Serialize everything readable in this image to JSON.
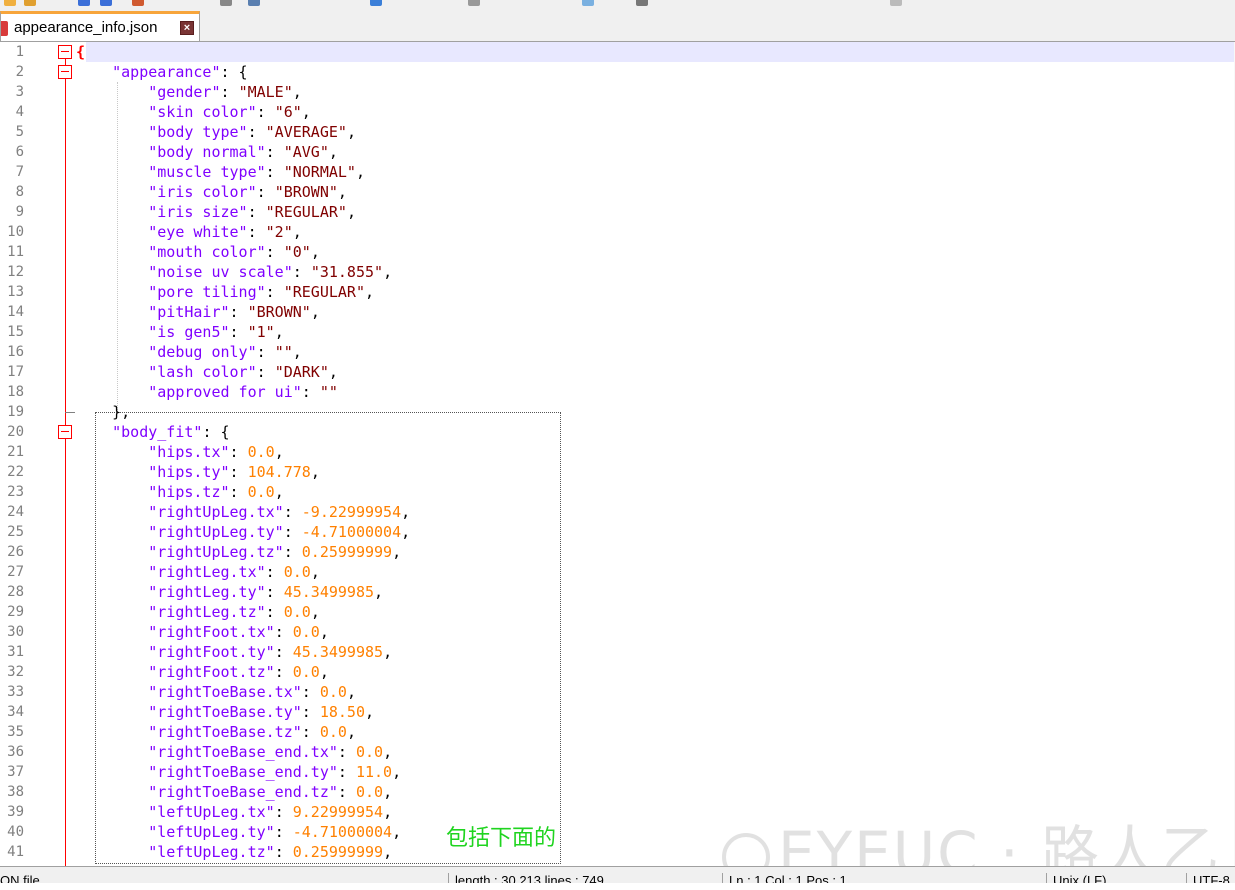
{
  "window": {
    "tab_title": "appearance_info.json",
    "close_glyph": "×"
  },
  "colors": {
    "key": "#8000ff",
    "string": "#800000",
    "number": "#ff8000",
    "fold_marker": "#ff0000",
    "caret_line": "#e8e8ff",
    "annotation": "#1fd41f"
  },
  "lines": [
    {
      "n": "1",
      "parts": [
        {
          "t": "{",
          "c": "brace-hl"
        }
      ]
    },
    {
      "n": "2",
      "parts": [
        {
          "t": "    "
        },
        {
          "t": "\"appearance\"",
          "c": "k"
        },
        {
          "t": ": {",
          "c": "p"
        }
      ]
    },
    {
      "n": "3",
      "parts": [
        {
          "t": "        "
        },
        {
          "t": "\"gender\"",
          "c": "k"
        },
        {
          "t": ": "
        },
        {
          "t": "\"MALE\"",
          "c": "s"
        },
        {
          "t": ","
        }
      ]
    },
    {
      "n": "4",
      "parts": [
        {
          "t": "        "
        },
        {
          "t": "\"skin color\"",
          "c": "k"
        },
        {
          "t": ": "
        },
        {
          "t": "\"6\"",
          "c": "s"
        },
        {
          "t": ","
        }
      ]
    },
    {
      "n": "5",
      "parts": [
        {
          "t": "        "
        },
        {
          "t": "\"body type\"",
          "c": "k"
        },
        {
          "t": ": "
        },
        {
          "t": "\"AVERAGE\"",
          "c": "s"
        },
        {
          "t": ","
        }
      ]
    },
    {
      "n": "6",
      "parts": [
        {
          "t": "        "
        },
        {
          "t": "\"body normal\"",
          "c": "k"
        },
        {
          "t": ": "
        },
        {
          "t": "\"AVG\"",
          "c": "s"
        },
        {
          "t": ","
        }
      ]
    },
    {
      "n": "7",
      "parts": [
        {
          "t": "        "
        },
        {
          "t": "\"muscle type\"",
          "c": "k"
        },
        {
          "t": ": "
        },
        {
          "t": "\"NORMAL\"",
          "c": "s"
        },
        {
          "t": ","
        }
      ]
    },
    {
      "n": "8",
      "parts": [
        {
          "t": "        "
        },
        {
          "t": "\"iris color\"",
          "c": "k"
        },
        {
          "t": ": "
        },
        {
          "t": "\"BROWN\"",
          "c": "s"
        },
        {
          "t": ","
        }
      ]
    },
    {
      "n": "9",
      "parts": [
        {
          "t": "        "
        },
        {
          "t": "\"iris size\"",
          "c": "k"
        },
        {
          "t": ": "
        },
        {
          "t": "\"REGULAR\"",
          "c": "s"
        },
        {
          "t": ","
        }
      ]
    },
    {
      "n": "10",
      "parts": [
        {
          "t": "        "
        },
        {
          "t": "\"eye white\"",
          "c": "k"
        },
        {
          "t": ": "
        },
        {
          "t": "\"2\"",
          "c": "s"
        },
        {
          "t": ","
        }
      ]
    },
    {
      "n": "11",
      "parts": [
        {
          "t": "        "
        },
        {
          "t": "\"mouth color\"",
          "c": "k"
        },
        {
          "t": ": "
        },
        {
          "t": "\"0\"",
          "c": "s"
        },
        {
          "t": ","
        }
      ]
    },
    {
      "n": "12",
      "parts": [
        {
          "t": "        "
        },
        {
          "t": "\"noise uv scale\"",
          "c": "k"
        },
        {
          "t": ": "
        },
        {
          "t": "\"31.855\"",
          "c": "s"
        },
        {
          "t": ","
        }
      ]
    },
    {
      "n": "13",
      "parts": [
        {
          "t": "        "
        },
        {
          "t": "\"pore tiling\"",
          "c": "k"
        },
        {
          "t": ": "
        },
        {
          "t": "\"REGULAR\"",
          "c": "s"
        },
        {
          "t": ","
        }
      ]
    },
    {
      "n": "14",
      "parts": [
        {
          "t": "        "
        },
        {
          "t": "\"pitHair\"",
          "c": "k"
        },
        {
          "t": ": "
        },
        {
          "t": "\"BROWN\"",
          "c": "s"
        },
        {
          "t": ","
        }
      ]
    },
    {
      "n": "15",
      "parts": [
        {
          "t": "        "
        },
        {
          "t": "\"is gen5\"",
          "c": "k"
        },
        {
          "t": ": "
        },
        {
          "t": "\"1\"",
          "c": "s"
        },
        {
          "t": ","
        }
      ]
    },
    {
      "n": "16",
      "parts": [
        {
          "t": "        "
        },
        {
          "t": "\"debug only\"",
          "c": "k"
        },
        {
          "t": ": "
        },
        {
          "t": "\"\"",
          "c": "s"
        },
        {
          "t": ","
        }
      ]
    },
    {
      "n": "17",
      "parts": [
        {
          "t": "        "
        },
        {
          "t": "\"lash color\"",
          "c": "k"
        },
        {
          "t": ": "
        },
        {
          "t": "\"DARK\"",
          "c": "s"
        },
        {
          "t": ","
        }
      ]
    },
    {
      "n": "18",
      "parts": [
        {
          "t": "        "
        },
        {
          "t": "\"approved for ui\"",
          "c": "k"
        },
        {
          "t": ": "
        },
        {
          "t": "\"\"",
          "c": "s"
        }
      ]
    },
    {
      "n": "19",
      "parts": [
        {
          "t": "    },"
        }
      ]
    },
    {
      "n": "20",
      "parts": [
        {
          "t": "    "
        },
        {
          "t": "\"body_fit\"",
          "c": "k"
        },
        {
          "t": ": {"
        }
      ]
    },
    {
      "n": "21",
      "parts": [
        {
          "t": "        "
        },
        {
          "t": "\"hips.tx\"",
          "c": "k"
        },
        {
          "t": ": "
        },
        {
          "t": "0.0",
          "c": "n"
        },
        {
          "t": ","
        }
      ]
    },
    {
      "n": "22",
      "parts": [
        {
          "t": "        "
        },
        {
          "t": "\"hips.ty\"",
          "c": "k"
        },
        {
          "t": ": "
        },
        {
          "t": "104.778",
          "c": "n"
        },
        {
          "t": ","
        }
      ]
    },
    {
      "n": "23",
      "parts": [
        {
          "t": "        "
        },
        {
          "t": "\"hips.tz\"",
          "c": "k"
        },
        {
          "t": ": "
        },
        {
          "t": "0.0",
          "c": "n"
        },
        {
          "t": ","
        }
      ]
    },
    {
      "n": "24",
      "parts": [
        {
          "t": "        "
        },
        {
          "t": "\"rightUpLeg.tx\"",
          "c": "k"
        },
        {
          "t": ": "
        },
        {
          "t": "-9.22999954",
          "c": "n"
        },
        {
          "t": ","
        }
      ]
    },
    {
      "n": "25",
      "parts": [
        {
          "t": "        "
        },
        {
          "t": "\"rightUpLeg.ty\"",
          "c": "k"
        },
        {
          "t": ": "
        },
        {
          "t": "-4.71000004",
          "c": "n"
        },
        {
          "t": ","
        }
      ]
    },
    {
      "n": "26",
      "parts": [
        {
          "t": "        "
        },
        {
          "t": "\"rightUpLeg.tz\"",
          "c": "k"
        },
        {
          "t": ": "
        },
        {
          "t": "0.25999999",
          "c": "n"
        },
        {
          "t": ","
        }
      ]
    },
    {
      "n": "27",
      "parts": [
        {
          "t": "        "
        },
        {
          "t": "\"rightLeg.tx\"",
          "c": "k"
        },
        {
          "t": ": "
        },
        {
          "t": "0.0",
          "c": "n"
        },
        {
          "t": ","
        }
      ]
    },
    {
      "n": "28",
      "parts": [
        {
          "t": "        "
        },
        {
          "t": "\"rightLeg.ty\"",
          "c": "k"
        },
        {
          "t": ": "
        },
        {
          "t": "45.3499985",
          "c": "n"
        },
        {
          "t": ","
        }
      ]
    },
    {
      "n": "29",
      "parts": [
        {
          "t": "        "
        },
        {
          "t": "\"rightLeg.tz\"",
          "c": "k"
        },
        {
          "t": ": "
        },
        {
          "t": "0.0",
          "c": "n"
        },
        {
          "t": ","
        }
      ]
    },
    {
      "n": "30",
      "parts": [
        {
          "t": "        "
        },
        {
          "t": "\"rightFoot.tx\"",
          "c": "k"
        },
        {
          "t": ": "
        },
        {
          "t": "0.0",
          "c": "n"
        },
        {
          "t": ","
        }
      ]
    },
    {
      "n": "31",
      "parts": [
        {
          "t": "        "
        },
        {
          "t": "\"rightFoot.ty\"",
          "c": "k"
        },
        {
          "t": ": "
        },
        {
          "t": "45.3499985",
          "c": "n"
        },
        {
          "t": ","
        }
      ]
    },
    {
      "n": "32",
      "parts": [
        {
          "t": "        "
        },
        {
          "t": "\"rightFoot.tz\"",
          "c": "k"
        },
        {
          "t": ": "
        },
        {
          "t": "0.0",
          "c": "n"
        },
        {
          "t": ","
        }
      ]
    },
    {
      "n": "33",
      "parts": [
        {
          "t": "        "
        },
        {
          "t": "\"rightToeBase.tx\"",
          "c": "k"
        },
        {
          "t": ": "
        },
        {
          "t": "0.0",
          "c": "n"
        },
        {
          "t": ","
        }
      ]
    },
    {
      "n": "34",
      "parts": [
        {
          "t": "        "
        },
        {
          "t": "\"rightToeBase.ty\"",
          "c": "k"
        },
        {
          "t": ": "
        },
        {
          "t": "18.50",
          "c": "n"
        },
        {
          "t": ","
        }
      ]
    },
    {
      "n": "35",
      "parts": [
        {
          "t": "        "
        },
        {
          "t": "\"rightToeBase.tz\"",
          "c": "k"
        },
        {
          "t": ": "
        },
        {
          "t": "0.0",
          "c": "n"
        },
        {
          "t": ","
        }
      ]
    },
    {
      "n": "36",
      "parts": [
        {
          "t": "        "
        },
        {
          "t": "\"rightToeBase_end.tx\"",
          "c": "k"
        },
        {
          "t": ": "
        },
        {
          "t": "0.0",
          "c": "n"
        },
        {
          "t": ","
        }
      ]
    },
    {
      "n": "37",
      "parts": [
        {
          "t": "        "
        },
        {
          "t": "\"rightToeBase_end.ty\"",
          "c": "k"
        },
        {
          "t": ": "
        },
        {
          "t": "11.0",
          "c": "n"
        },
        {
          "t": ","
        }
      ]
    },
    {
      "n": "38",
      "parts": [
        {
          "t": "        "
        },
        {
          "t": "\"rightToeBase_end.tz\"",
          "c": "k"
        },
        {
          "t": ": "
        },
        {
          "t": "0.0",
          "c": "n"
        },
        {
          "t": ","
        }
      ]
    },
    {
      "n": "39",
      "parts": [
        {
          "t": "        "
        },
        {
          "t": "\"leftUpLeg.tx\"",
          "c": "k"
        },
        {
          "t": ": "
        },
        {
          "t": "9.22999954",
          "c": "n"
        },
        {
          "t": ","
        }
      ]
    },
    {
      "n": "40",
      "parts": [
        {
          "t": "        "
        },
        {
          "t": "\"leftUpLeg.ty\"",
          "c": "k"
        },
        {
          "t": ": "
        },
        {
          "t": "-4.71000004",
          "c": "n"
        },
        {
          "t": ","
        }
      ]
    },
    {
      "n": "41",
      "parts": [
        {
          "t": "        "
        },
        {
          "t": "\"leftUpLeg.tz\"",
          "c": "k"
        },
        {
          "t": ": "
        },
        {
          "t": "0.25999999",
          "c": "n"
        },
        {
          "t": ","
        }
      ]
    }
  ],
  "annotation": "包括下面的",
  "watermark": "EYEUC · 路人乙",
  "watermark_icon": "eyeuc-logo-icon",
  "statusbar": {
    "file_type": "ON file",
    "length_lines": "length : 30,213    lines : 749",
    "position": "Ln : 1    Col : 1    Pos : 1",
    "eol": "Unix (LF)",
    "encoding": "UTF-8"
  }
}
